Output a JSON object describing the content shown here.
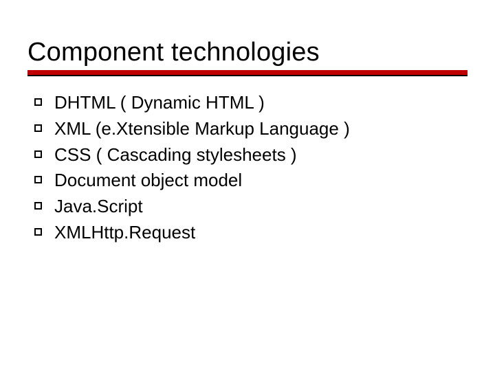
{
  "slide": {
    "title": "Component technologies",
    "bullets": [
      "DHTML ( Dynamic HTML )",
      "XML (e.Xtensible Markup Language )",
      "CSS ( Cascading stylesheets )",
      "Document object model",
      "Java.Script",
      "XMLHttp.Request"
    ]
  }
}
